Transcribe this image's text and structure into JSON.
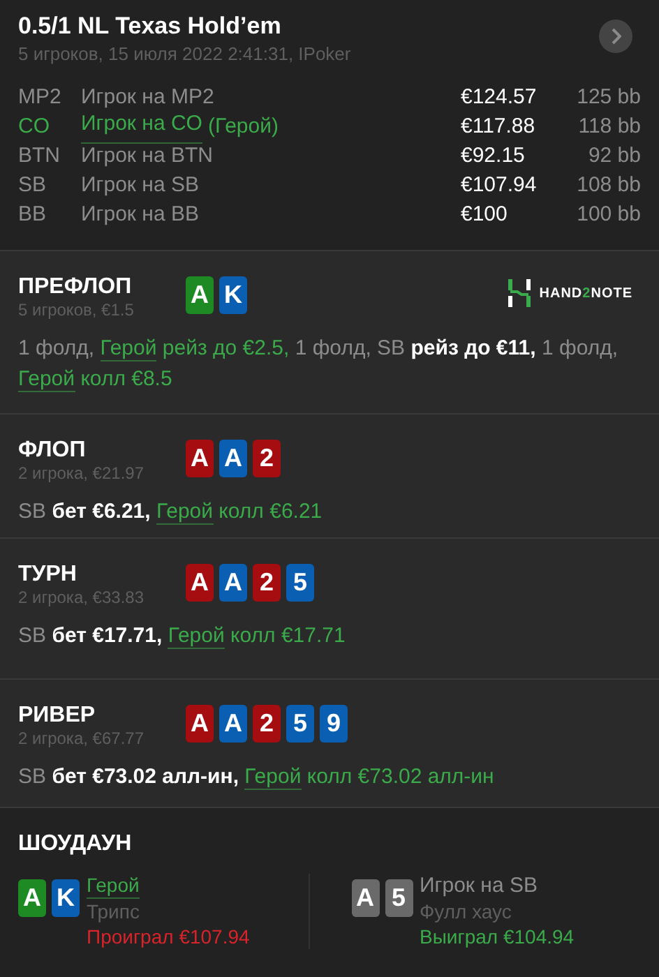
{
  "header": {
    "title": "0.5/1 NL Texas Hold’em",
    "subtitle": "5 игроков, 15 июля 2022 2:41:31, IPoker"
  },
  "players": [
    {
      "position": "MP2",
      "name": "Игрок на MP2",
      "hero": false,
      "stack": "€124.57",
      "bb": "125 bb"
    },
    {
      "position": "CO",
      "name": "Игрок на CO",
      "hero_tag": "(Герой)",
      "hero": true,
      "stack": "€117.88",
      "bb": "118 bb"
    },
    {
      "position": "BTN",
      "name": "Игрок на BTN",
      "hero": false,
      "stack": "€92.15",
      "bb": "92 bb"
    },
    {
      "position": "SB",
      "name": "Игрок на SB",
      "hero": false,
      "stack": "€107.94",
      "bb": "108 bb"
    },
    {
      "position": "BB",
      "name": "Игрок на BB",
      "hero": false,
      "stack": "€100",
      "bb": "100 bb"
    }
  ],
  "streets": [
    {
      "title": "ПРЕФЛОП",
      "info": "5 игроков, €1.5",
      "logo": {
        "before": "HAND",
        "accent": "2",
        "after": "NOTE"
      },
      "cards": [
        {
          "rank": "A",
          "color": "#1d8a24"
        },
        {
          "rank": "K",
          "color": "#0b5fb3"
        }
      ],
      "actions": [
        {
          "kind": "muted",
          "text": "1 фолд, "
        },
        {
          "kind": "hero_link",
          "text": "Герой"
        },
        {
          "kind": "hero",
          "text": " рейз до €2.5,"
        },
        {
          "kind": "muted",
          "text": " 1 фолд, SB "
        },
        {
          "kind": "bold",
          "text": "рейз до €11,"
        },
        {
          "kind": "muted",
          "text": " 1 фолд, "
        },
        {
          "kind": "hero_link",
          "text": "Герой"
        },
        {
          "kind": "hero",
          "text": " колл €8.5"
        }
      ]
    },
    {
      "title": "ФЛОП",
      "info": "2 игрока, €21.97",
      "cards": [
        {
          "rank": "A",
          "color": "#a50d10"
        },
        {
          "rank": "A",
          "color": "#0b5fb3"
        },
        {
          "rank": "2",
          "color": "#a50d10"
        }
      ],
      "actions": [
        {
          "kind": "muted",
          "text": "SB "
        },
        {
          "kind": "bold",
          "text": "бет €6.21, "
        },
        {
          "kind": "hero_link",
          "text": "Герой"
        },
        {
          "kind": "hero",
          "text": " колл €6.21"
        }
      ]
    },
    {
      "title": "ТУРН",
      "info": "2 игрока, €33.83",
      "cards": [
        {
          "rank": "A",
          "color": "#a50d10"
        },
        {
          "rank": "A",
          "color": "#0b5fb3"
        },
        {
          "rank": "2",
          "color": "#a50d10"
        },
        {
          "rank": "5",
          "color": "#0b5fb3"
        }
      ],
      "actions": [
        {
          "kind": "muted",
          "text": "SB "
        },
        {
          "kind": "bold",
          "text": "бет €17.71, "
        },
        {
          "kind": "hero_link",
          "text": "Герой"
        },
        {
          "kind": "hero",
          "text": " колл €17.71"
        }
      ]
    },
    {
      "title": "РИВЕР",
      "info": "2 игрока, €67.77",
      "cards": [
        {
          "rank": "A",
          "color": "#a50d10"
        },
        {
          "rank": "A",
          "color": "#0b5fb3"
        },
        {
          "rank": "2",
          "color": "#a50d10"
        },
        {
          "rank": "5",
          "color": "#0b5fb3"
        },
        {
          "rank": "9",
          "color": "#0b5fb3"
        }
      ],
      "actions": [
        {
          "kind": "muted",
          "text": "SB "
        },
        {
          "kind": "bold",
          "text": "бет €73.02 алл-ин, "
        },
        {
          "kind": "hero_link",
          "text": "Герой"
        },
        {
          "kind": "hero",
          "text": " колл €73.02 алл-ин"
        }
      ]
    }
  ],
  "showdown": {
    "title": "ШОУДАУН",
    "hands": [
      {
        "name": "Герой",
        "hero": true,
        "hand": "Трипс",
        "result": "Проиграл €107.94",
        "won": false,
        "cards": [
          {
            "rank": "A",
            "color": "#1d8a24"
          },
          {
            "rank": "K",
            "color": "#0b5fb3"
          }
        ]
      },
      {
        "name": "Игрок на SB",
        "hero": false,
        "hand": "Фулл хаус",
        "result": "Выиграл €104.94",
        "won": true,
        "cards": [
          {
            "rank": "A",
            "color": "#6a6a6a"
          },
          {
            "rank": "5",
            "color": "#6a6a6a"
          }
        ]
      }
    ]
  }
}
